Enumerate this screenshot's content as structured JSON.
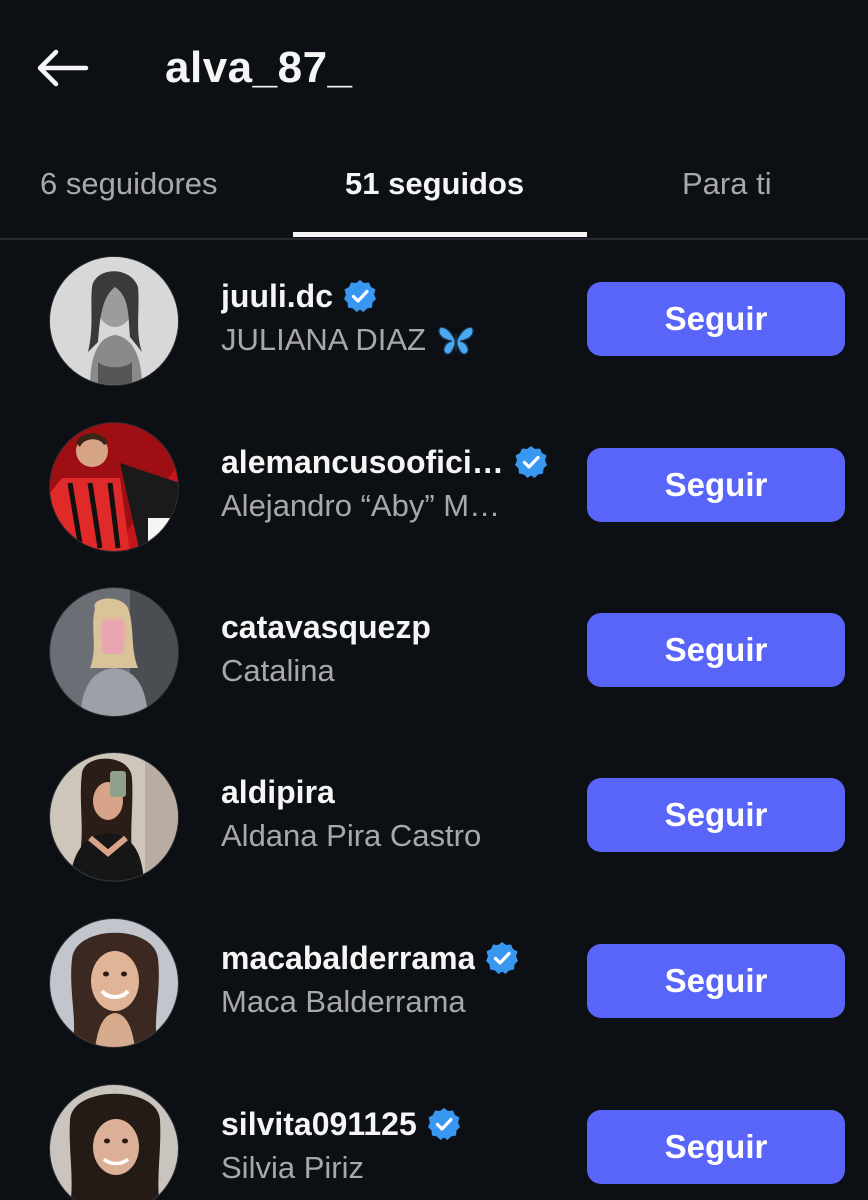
{
  "header": {
    "title": "alva_87_",
    "back_icon": "arrow-left-icon"
  },
  "tabs": [
    {
      "label": "6 seguidores",
      "active": false
    },
    {
      "label": "51 seguidos",
      "active": true
    },
    {
      "label": "Para ti",
      "active": false
    }
  ],
  "colors": {
    "background": "#0c1014",
    "accent": "#5865f8",
    "verified": "#3897f0",
    "secondary_text": "#a8a8a8"
  },
  "following": [
    {
      "username": "juuli.dc",
      "full_name": "JULIANA DIAZ",
      "verified": true,
      "emoji": "butterfly",
      "button": "Seguir"
    },
    {
      "username": "alemancusoofici…",
      "full_name": "Alejandro “Aby” M…",
      "verified": true,
      "button": "Seguir"
    },
    {
      "username": "catavasquezp",
      "full_name": "Catalina",
      "verified": false,
      "button": "Seguir"
    },
    {
      "username": "aldipira",
      "full_name": "Aldana Pira Castro",
      "verified": false,
      "button": "Seguir"
    },
    {
      "username": "macabalderrama",
      "full_name": "Maca Balderrama",
      "verified": true,
      "button": "Seguir"
    },
    {
      "username": "silvita091125",
      "full_name": "Silvia Piriz",
      "verified": true,
      "button": "Seguir"
    }
  ]
}
